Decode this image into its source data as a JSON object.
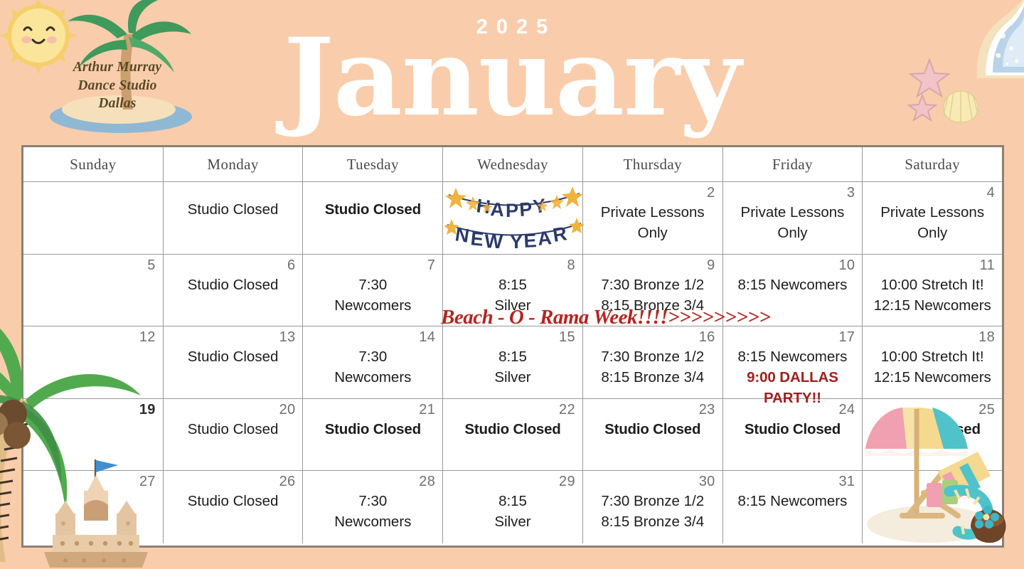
{
  "brand": {
    "line1": "Arthur Murray",
    "line2": "Dance Studio",
    "line3": "Dallas"
  },
  "header": {
    "year": "2025",
    "month": "January"
  },
  "colors": {
    "background": "#f9cdab",
    "grid_border": "#8a8078",
    "cell_line": "#9a9a9a",
    "accent_red": "#a01f1f",
    "banner_red": "#b5251f",
    "logo_brown": "#59492a",
    "title_white": "#ffffff"
  },
  "weekday_headers": [
    "Sunday",
    "Monday",
    "Tuesday",
    "Wednesday",
    "Thursday",
    "Friday",
    "Saturday"
  ],
  "span_banner": {
    "text": "Beach - O - Rama Week!!!!>>>>>>>>>",
    "starts_day": 22,
    "ends_day": 24
  },
  "graphics": [
    "sun-icon",
    "palm-island-icon",
    "ocean-wave-icon",
    "starfish-icon",
    "seashell-icon",
    "happy-new-year-banner-icon",
    "palm-tree-icon",
    "sandcastle-icon",
    "beach-umbrella-chair-icon"
  ],
  "weeks": [
    [
      {
        "num": "",
        "events": []
      },
      {
        "num": "",
        "events": [
          {
            "text": "Studio Closed",
            "style": "plain"
          }
        ]
      },
      {
        "num": "",
        "events": [
          {
            "text": "Studio Closed",
            "style": "bold"
          }
        ]
      },
      {
        "num": "",
        "events": [],
        "art": "happy-new-year-banner"
      },
      {
        "num": "2",
        "events": [
          {
            "text": "Private Lessons",
            "style": "plain"
          },
          {
            "text": "Only",
            "style": "plain"
          }
        ]
      },
      {
        "num": "3",
        "events": [
          {
            "text": "Private Lessons",
            "style": "plain"
          },
          {
            "text": "Only",
            "style": "plain"
          }
        ]
      },
      {
        "num": "4",
        "events": [
          {
            "text": "Private Lessons",
            "style": "plain"
          },
          {
            "text": "Only",
            "style": "plain"
          }
        ]
      }
    ],
    [
      {
        "num": "5",
        "events": []
      },
      {
        "num": "6",
        "events": [
          {
            "text": "Studio Closed",
            "style": "plain"
          }
        ]
      },
      {
        "num": "7",
        "events": [
          {
            "text": "7:30",
            "style": "plain"
          },
          {
            "text": "Newcomers",
            "style": "plain"
          }
        ]
      },
      {
        "num": "8",
        "events": [
          {
            "text": "8:15",
            "style": "plain"
          },
          {
            "text": "Silver",
            "style": "plain"
          }
        ]
      },
      {
        "num": "9",
        "events": [
          {
            "text": "7:30 Bronze 1/2",
            "style": "plain"
          },
          {
            "text": "8:15 Bronze 3/4",
            "style": "plain"
          }
        ]
      },
      {
        "num": "10",
        "events": [
          {
            "text": "8:15 Newcomers",
            "style": "plain"
          }
        ]
      },
      {
        "num": "11",
        "events": [
          {
            "text": "10:00 Stretch It!",
            "style": "plain"
          },
          {
            "text": "12:15 Newcomers",
            "style": "plain"
          }
        ]
      }
    ],
    [
      {
        "num": "12",
        "events": []
      },
      {
        "num": "13",
        "events": [
          {
            "text": "Studio Closed",
            "style": "plain"
          }
        ]
      },
      {
        "num": "14",
        "events": [
          {
            "text": "7:30",
            "style": "plain"
          },
          {
            "text": "Newcomers",
            "style": "plain"
          }
        ]
      },
      {
        "num": "15",
        "events": [
          {
            "text": "8:15",
            "style": "plain"
          },
          {
            "text": "Silver",
            "style": "plain"
          }
        ]
      },
      {
        "num": "16",
        "events": [
          {
            "text": "7:30 Bronze 1/2",
            "style": "plain"
          },
          {
            "text": "8:15 Bronze 3/4",
            "style": "plain"
          }
        ]
      },
      {
        "num": "17",
        "events": [
          {
            "text": "8:15 Newcomers",
            "style": "plain"
          },
          {
            "text": "9:00 DALLAS",
            "style": "red"
          },
          {
            "text": "PARTY!!",
            "style": "red"
          }
        ]
      },
      {
        "num": "18",
        "events": [
          {
            "text": "10:00 Stretch It!",
            "style": "plain"
          },
          {
            "text": "12:15 Newcomers",
            "style": "plain"
          }
        ]
      }
    ],
    [
      {
        "num": "19",
        "events": [],
        "num_strong": true
      },
      {
        "num": "20",
        "events": [
          {
            "text": "Studio Closed",
            "style": "plain"
          }
        ]
      },
      {
        "num": "21",
        "events": [
          {
            "text": "Studio Closed",
            "style": "bold"
          }
        ]
      },
      {
        "num": "22",
        "events": [
          {
            "text": "Studio Closed",
            "style": "bold"
          }
        ]
      },
      {
        "num": "23",
        "events": [
          {
            "text": "Studio Closed",
            "style": "bold"
          }
        ]
      },
      {
        "num": "24",
        "events": [
          {
            "text": "Studio Closed",
            "style": "bold"
          }
        ]
      },
      {
        "num": "25",
        "events": [
          {
            "text": "Studio Closed",
            "style": "bold"
          }
        ],
        "art": "beach-umbrella-chair"
      }
    ],
    [
      {
        "num": "27",
        "events": []
      },
      {
        "num": "26",
        "events": [
          {
            "text": "Studio Closed",
            "style": "plain"
          }
        ]
      },
      {
        "num": "28",
        "events": [
          {
            "text": "7:30",
            "style": "plain"
          },
          {
            "text": "Newcomers",
            "style": "plain"
          }
        ]
      },
      {
        "num": "29",
        "events": [
          {
            "text": "8:15",
            "style": "plain"
          },
          {
            "text": "Silver",
            "style": "plain"
          }
        ]
      },
      {
        "num": "30",
        "events": [
          {
            "text": "7:30 Bronze 1/2",
            "style": "plain"
          },
          {
            "text": "8:15 Bronze 3/4",
            "style": "plain"
          }
        ]
      },
      {
        "num": "31",
        "events": [
          {
            "text": "8:15 Newcomers",
            "style": "plain"
          }
        ]
      },
      {
        "num": "",
        "events": []
      }
    ]
  ]
}
